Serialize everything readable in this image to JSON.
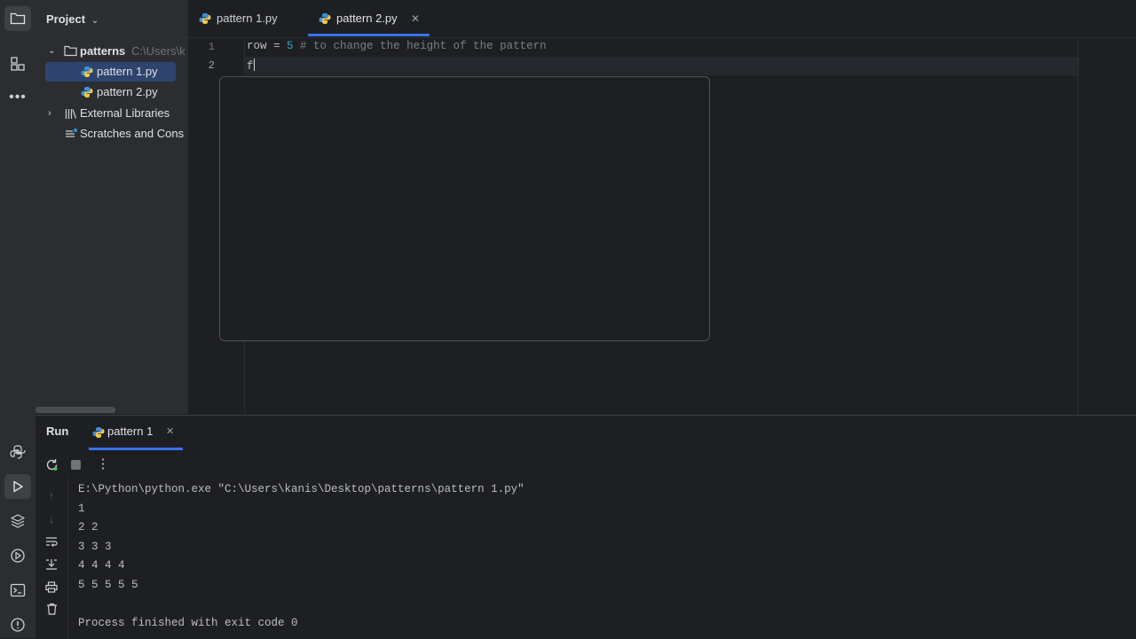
{
  "colors": {
    "accent": "#3574f0",
    "selection": "#2e436e",
    "keyword_number": "#2aacb8",
    "comment": "#7a7e85"
  },
  "sidebar": {
    "icons": [
      "folder-icon",
      "structure-icon",
      "more-icon",
      "python-console-icon",
      "run-icon",
      "layers-icon",
      "services-icon",
      "terminal-icon",
      "problems-icon"
    ]
  },
  "project": {
    "title": "Project",
    "root_name": "patterns",
    "root_path": "C:\\Users\\k",
    "files": [
      "pattern 1.py",
      "pattern 2.py"
    ],
    "external_libraries": "External Libraries",
    "scratches": "Scratches and Cons"
  },
  "editor": {
    "tabs": [
      {
        "label": "pattern 1.py"
      },
      {
        "label": "pattern 2.py"
      }
    ],
    "line_numbers": [
      "1",
      "2"
    ],
    "line1": {
      "var": "row",
      "op": " = ",
      "num": "5",
      "comment": " # to change the height of the pattern"
    },
    "line2": "f"
  },
  "run": {
    "title": "Run",
    "tab_label": "pattern 1",
    "command": "E:\\Python\\python.exe \"C:\\Users\\kanis\\Desktop\\patterns\\pattern 1.py\"",
    "output": [
      "1",
      "2 2",
      "3 3 3",
      "4 4 4 4",
      "5 5 5 5 5"
    ],
    "exit": "Process finished with exit code 0"
  }
}
